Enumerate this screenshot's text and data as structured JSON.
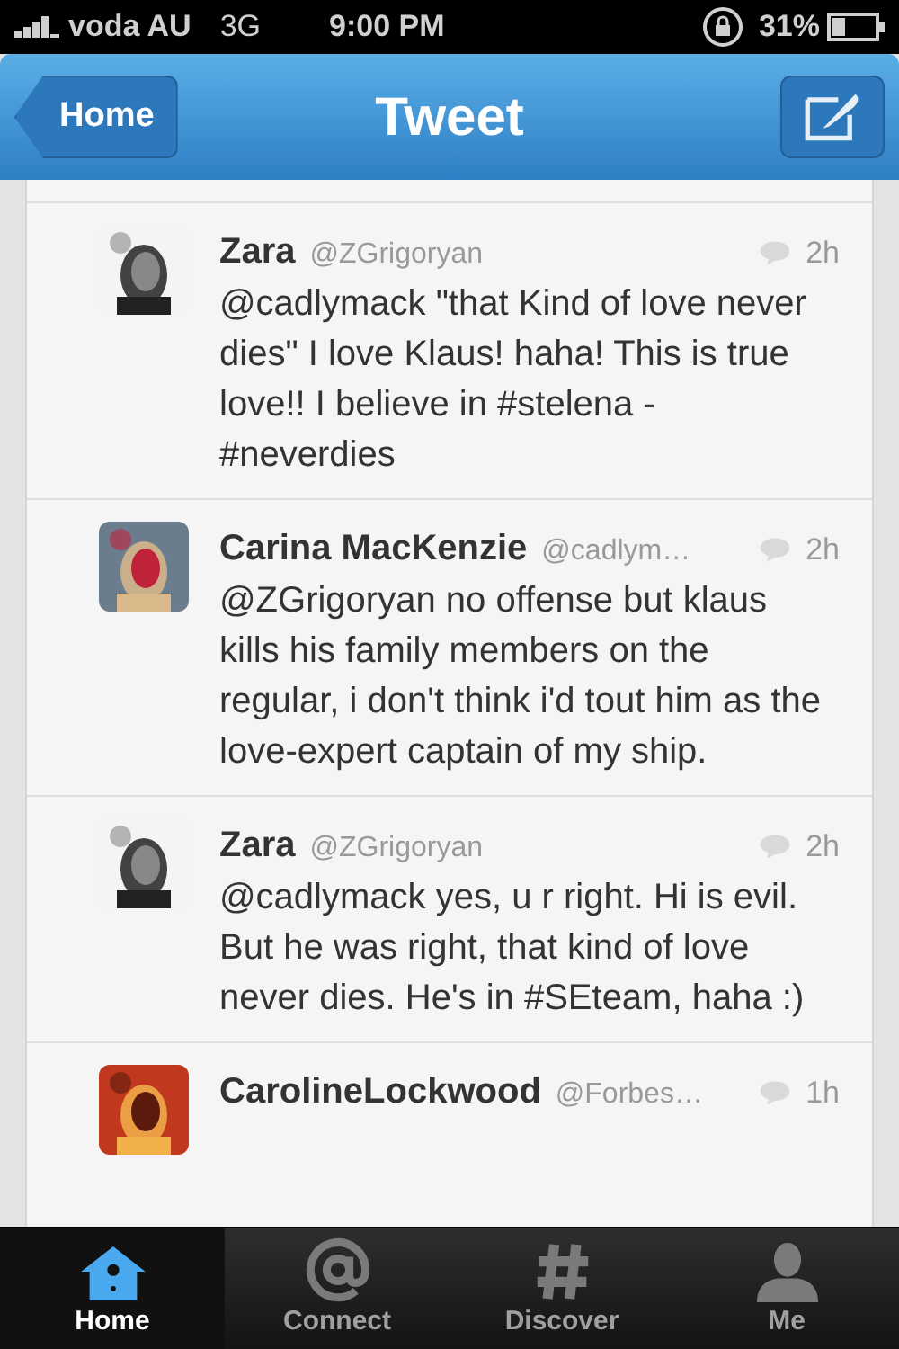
{
  "status_bar": {
    "carrier": "voda AU",
    "network": "3G",
    "time": "9:00 PM",
    "battery": "31%"
  },
  "nav": {
    "back": "Home",
    "title": "Tweet"
  },
  "tweets": [
    {
      "name": "Zara",
      "handle": "@ZGrigoryan",
      "time": "2h",
      "text": "@cadlymack \"that Kind of love never dies\" I love Klaus! haha! This is true  love!! I believe in #stelena - #neverdies"
    },
    {
      "name": "Carina MacKenzie",
      "handle": "@cadlym…",
      "time": "2h",
      "text": "@ZGrigoryan no offense but klaus kills his family members on the regular, i don't think i'd tout him as the love-expert captain of my ship."
    },
    {
      "name": "Zara",
      "handle": "@ZGrigoryan",
      "time": "2h",
      "text": "@cadlymack yes, u r right. Hi is evil. But he was right, that kind of love never dies. He's in #SEteam, haha :)"
    },
    {
      "name": "CarolineLockwood",
      "handle": "@Forbes…",
      "time": "1h"
    }
  ],
  "tab_bar": [
    {
      "label": "Home",
      "kind": "home",
      "selected": true
    },
    {
      "label": "Connect",
      "kind": "at",
      "selected": false
    },
    {
      "label": "Discover",
      "kind": "hash",
      "selected": false
    },
    {
      "label": "Me",
      "kind": "person",
      "selected": false
    }
  ]
}
